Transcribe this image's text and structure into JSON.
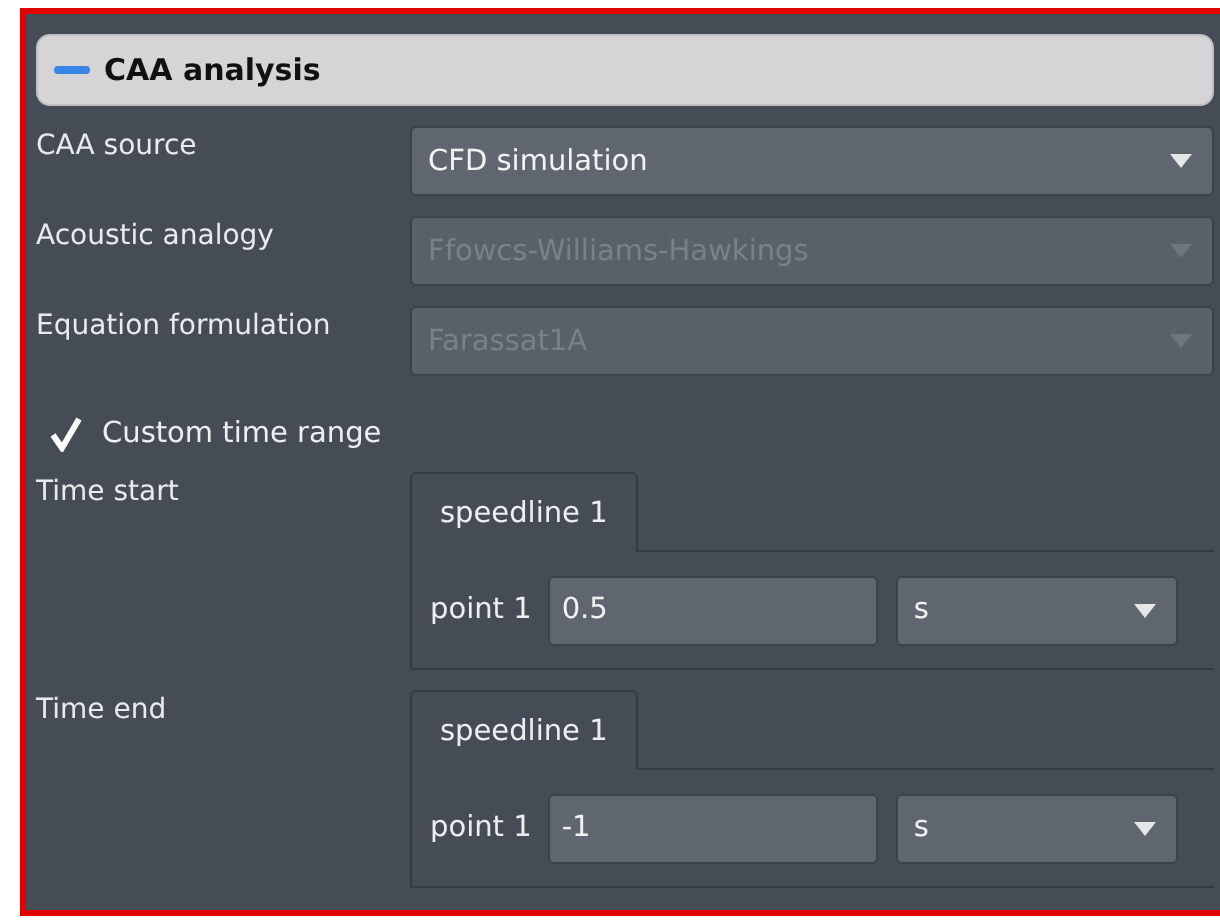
{
  "section": {
    "title": "CAA analysis",
    "expanded": true
  },
  "fields": [
    {
      "label": "CAA source",
      "value": "CFD simulation",
      "disabled": false
    },
    {
      "label": "Acoustic analogy",
      "value": "Ffowcs-Williams-Hawkings",
      "disabled": true
    },
    {
      "label": "Equation formulation",
      "value": "Farassat1A",
      "disabled": true
    }
  ],
  "custom_time_range": {
    "label": "Custom time range",
    "checked": true
  },
  "time_fields": [
    {
      "label": "Time start",
      "tabs": [
        {
          "label": "speedline 1",
          "selected": true
        }
      ],
      "points": [
        {
          "label": "point 1",
          "value": "0.5",
          "unit": "s"
        }
      ]
    },
    {
      "label": "Time end",
      "tabs": [
        {
          "label": "speedline 1",
          "selected": true
        }
      ],
      "points": [
        {
          "label": "point 1",
          "value": "-1",
          "unit": "s"
        }
      ]
    }
  ]
}
